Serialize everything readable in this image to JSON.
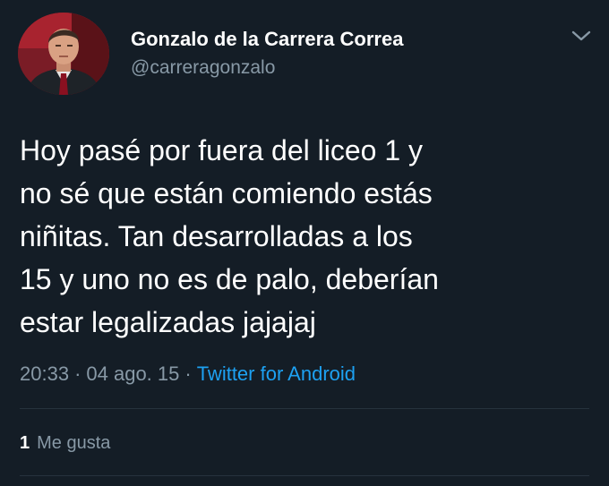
{
  "tweet": {
    "author": {
      "name": "Gonzalo de la Carrera Correa",
      "handle": "@carreragonzalo"
    },
    "text_lines": [
      "Hoy pasé por fuera del liceo 1 y",
      "no sé que están comiendo estás",
      "niñitas. Tan desarrolladas a los",
      "15 y uno no es de palo, deberían",
      "estar legalizadas jajajaj"
    ],
    "meta": {
      "time": "20:33",
      "separator": "·",
      "date": "04 ago. 15",
      "client": "Twitter for Android"
    },
    "likes": {
      "count": "1",
      "label": "Me gusta"
    }
  },
  "icons": {
    "caret": "chevron-down-icon",
    "avatar": "avatar"
  },
  "colors": {
    "background": "#141d26",
    "text_primary": "#ffffff",
    "text_secondary": "#8899a6",
    "link": "#1da1f2",
    "divider": "#26323d"
  }
}
